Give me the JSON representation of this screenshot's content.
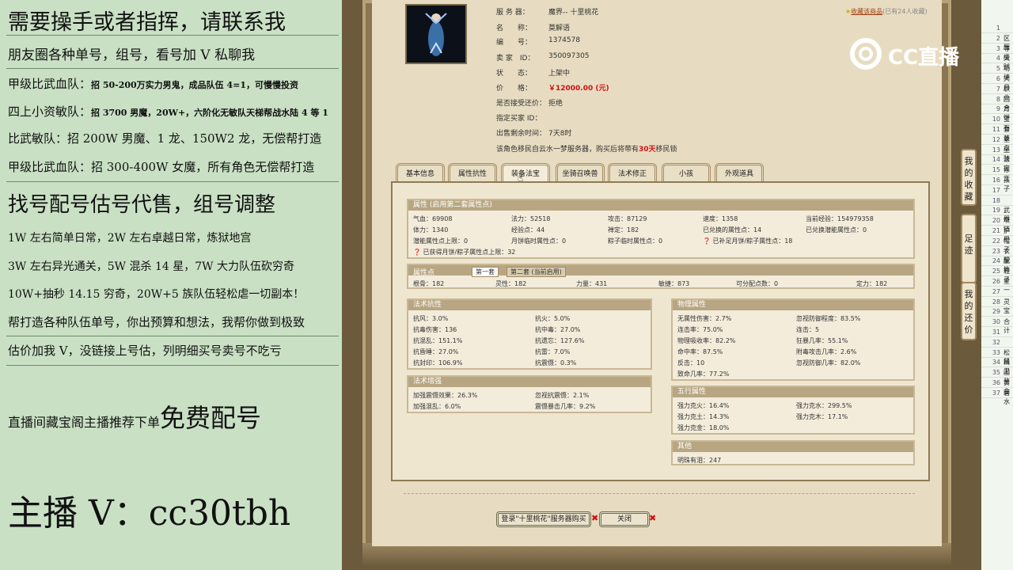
{
  "overlay": {
    "l1": "需要操手或者指挥，请联系我",
    "l2": "朋友圈各种单号，组号，看号加 V 私聊我",
    "l3_a": "甲级比武血队：",
    "l3_b": "招 50-200万实力男鬼，成品队伍 4=1，可慢慢投资",
    "l4_a": "四上小资敏队：",
    "l4_b": "招 3700 男魔，20W+，六阶化无敏队天梯帮战水陆 4 等 1",
    "l5": "比武敏队：招 200W 男魔、1 龙、150W2 龙，无偿帮打造",
    "l6": "甲级比武血队：招 300-400W 女魔，所有角色无偿帮打造",
    "l7": "找号配号估号代售，组号调整",
    "l8": "1W 左右简单日常，2W 左右卓越日常，炼狱地宫",
    "l9": "3W 左右异光通关，5W 混杀 14 星，7W 大力队伍砍穷奇",
    "l10": "10W+抽秒 14.15 穷奇，20W+5 族队伍轻松虐一切副本！",
    "l11": "帮打造各种队伍单号，你出预算和想法，我帮你做到极致",
    "l12": "估价加我 V，没链接上号估，列明细买号卖号不吃亏",
    "l13_a": "直播间藏宝阁主播推荐下单",
    "l13_b": "免费配号",
    "l14": "主播 V：cc30tbh"
  },
  "logo": "CC直播",
  "header": {
    "server_label": "服 务 器：",
    "server": "魔界-- 十里桃花",
    "name_label": "名　　称：",
    "name": "莫解语",
    "id_label": "编　　号：",
    "id": "1374578",
    "seller_label": "卖 家　ID：",
    "seller": "350097305",
    "state_label": "状　　态：",
    "state": "上架中",
    "price_label": "价　　格：",
    "price": "￥12000.00 (元)",
    "bargain_label": "是否接受还价：",
    "bargain": "拒绝",
    "buyer_label": "指定买家 ID：",
    "remain_label": "出售剩余时间：",
    "remain": "7天8时",
    "note_pre": "该角色移民自云水一梦服务器，购买后将带有",
    "note_days": "30天",
    "note_post": "移民锁",
    "fav_link": "收藏该商品",
    "fav_count": "(已有24人收藏)"
  },
  "tabs": [
    "基本信息",
    "属性抗性",
    "装备法宝",
    "坐骑召唤兽",
    "法术修正",
    "小孩",
    "外观道具"
  ],
  "attr": {
    "title": "属性 (启用第二套属性点)",
    "rows": [
      [
        "气血：69908",
        "法力：52518",
        "攻击：87129",
        "速度：1358",
        "当前经验：154979358"
      ],
      [
        "体力：1340",
        "经验点：44",
        "禅定：182",
        "已兑换的属性点：14",
        "已兑换潜能属性点：0"
      ],
      [
        "潜能属性点上限：0",
        "月饼临时属性点：0",
        "粽子临时属性点：0",
        "❓ 已补足月饼/粽子属性点：18",
        ""
      ]
    ],
    "extra": "❓ 已获得月饼/粽子属性点上限：32"
  },
  "points": {
    "title": "属性点",
    "tab1": "第一套",
    "tab2": "第二套 (当前启用)",
    "cells": [
      "根骨：182",
      "灵性：182",
      "力量：431",
      "敏捷：873",
      "可分配点数：0",
      "定力：182"
    ]
  },
  "resist": {
    "title": "法术抗性",
    "cells": [
      "抗风：3.0%",
      "抗火：5.0%",
      "抗毒伤害：136",
      "抗中毒：27.0%",
      "抗混乱：151.1%",
      "抗遗忘：127.6%",
      "抗昏睡：27.0%",
      "抗雷：7.0%",
      "抗封印：106.9%",
      "抗震慑：0.3%"
    ]
  },
  "enhance": {
    "title": "法术增强",
    "cells": [
      "加强震慑效果：26.3%",
      "忽视抗震慑：2.1%",
      "加强混乱：6.0%",
      "震慑暴击几率：9.2%"
    ]
  },
  "phys": {
    "title": "物理属性",
    "cells": [
      "无属性伤害：2.7%",
      "忽视防御程度：83.5%",
      "连击率：75.0%",
      "连击：5",
      "物理吸收率：82.2%",
      "狂暴几率：55.1%",
      "命中率：87.5%",
      "附毒攻击几率：2.6%",
      "反击：10",
      "忽视防御几率：82.0%",
      "致命几率：77.2%",
      ""
    ]
  },
  "wuxing": {
    "title": "五行属性",
    "cells": [
      "强力克火：16.4%",
      "强力克水：299.5%",
      "强力克土：14.3%",
      "强力克木：17.1%",
      "强力克金：18.0%",
      ""
    ]
  },
  "other": {
    "title": "其他",
    "cells": [
      "明珠有泪：247"
    ]
  },
  "buttons": {
    "login": "登录\"十里桃花\"服务器购买",
    "close": "关闭"
  },
  "side": {
    "fav": "我的收藏",
    "footprint": "足迹",
    "bargain": "我的还价"
  },
  "sheet_rows": [
    {
      "n": "1",
      "t": ""
    },
    {
      "n": "2",
      "t": "区服"
    },
    {
      "n": "3",
      "t": "等级"
    },
    {
      "n": "4",
      "t": "天赋"
    },
    {
      "n": "5",
      "t": "功绩"
    },
    {
      "n": "6",
      "t": "大月"
    },
    {
      "n": "7",
      "t": "职业"
    },
    {
      "n": "8",
      "t": "回合"
    },
    {
      "n": "9",
      "t": "月饼"
    },
    {
      "n": "10",
      "t": "宝石"
    },
    {
      "n": "11",
      "t": "套装"
    },
    {
      "n": "12",
      "t": "星盘"
    },
    {
      "n": "13",
      "t": "坐骑"
    },
    {
      "n": "14",
      "t": "法宝"
    },
    {
      "n": "15",
      "t": "修正"
    },
    {
      "n": "16",
      "t": "孩子"
    },
    {
      "n": "17",
      "t": ""
    },
    {
      "n": "18",
      "t": ""
    },
    {
      "n": "19",
      "t": "武器"
    },
    {
      "n": "20",
      "t": "项链"
    },
    {
      "n": "21",
      "t": "护甲"
    },
    {
      "n": "22",
      "t": "帽子"
    },
    {
      "n": "23",
      "t": "衣服"
    },
    {
      "n": "24",
      "t": "配饰"
    },
    {
      "n": "25",
      "t": "鞋子"
    },
    {
      "n": "26",
      "t": "星一"
    },
    {
      "n": "27",
      "t": ""
    },
    {
      "n": "28",
      "t": "灵宝"
    },
    {
      "n": "29",
      "t": ""
    },
    {
      "n": "30",
      "t": "合计"
    },
    {
      "n": "31",
      "t": ""
    },
    {
      "n": "32",
      "t": ""
    },
    {
      "n": "33",
      "t": "松鼠"
    },
    {
      "n": "34",
      "t": "精卫"
    },
    {
      "n": "35",
      "t": "图鉴"
    },
    {
      "n": "36",
      "t": "黄金"
    },
    {
      "n": "37",
      "t": "碧水"
    }
  ]
}
